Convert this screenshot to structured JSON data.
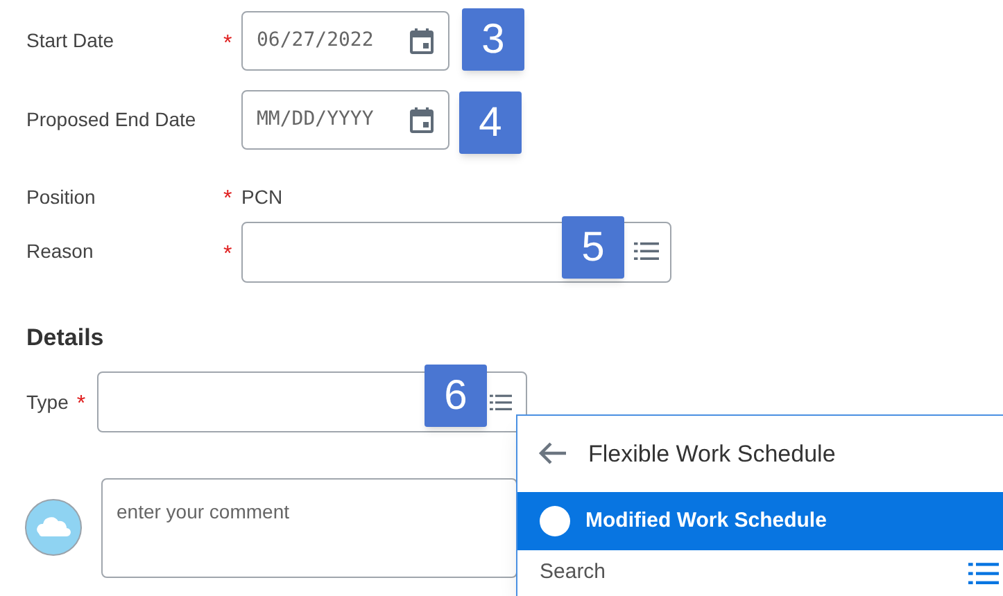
{
  "fields": [
    {
      "label": "Start Date",
      "required_mark": "*",
      "kind": "date",
      "value": "06/27/2022",
      "badge": "3"
    },
    {
      "label": "Proposed End Date",
      "kind": "date",
      "placeholder": "MM/DD/YYYY",
      "badge": "4"
    },
    {
      "label": "Position",
      "required_mark": "*",
      "kind": "static",
      "value": "PCN"
    },
    {
      "label": "Reason",
      "required_mark": "*",
      "kind": "select",
      "badge": "5"
    }
  ],
  "details": {
    "heading": "Details",
    "type_field": {
      "label": "Type",
      "required_mark": "*",
      "badge": "6"
    }
  },
  "comment": {
    "placeholder": "enter your comment"
  },
  "dropdown": {
    "title": "Flexible Work Schedule",
    "options": [
      {
        "label": "Modified Work Schedule",
        "selected": true
      }
    ],
    "search": {
      "placeholder": "Search"
    }
  }
}
